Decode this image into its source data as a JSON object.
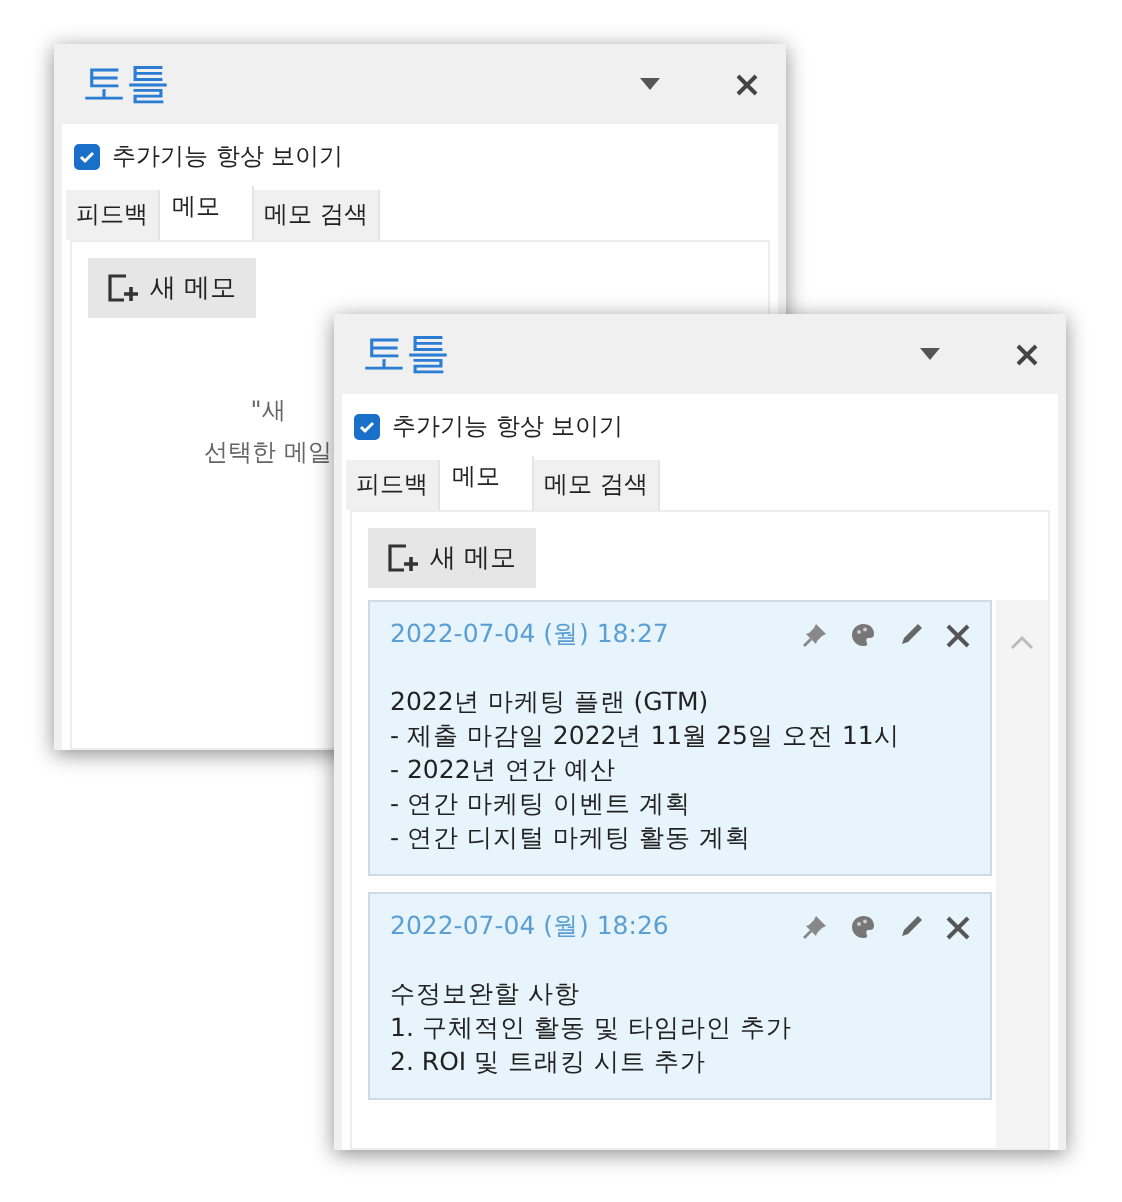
{
  "windows": [
    {
      "title": "토틀",
      "show_addins": {
        "label": "추가기능 항상 보이기",
        "checked": true
      },
      "tabs": [
        {
          "label": "피드백",
          "selected": false
        },
        {
          "label": "메모",
          "selected": true
        },
        {
          "label": "메모 검색",
          "selected": false
        }
      ],
      "new_memo_button": "새 메모",
      "empty_message": [
        "\"새",
        "선택한 메일"
      ]
    },
    {
      "title": "토틀",
      "show_addins": {
        "label": "추가기능 항상 보이기",
        "checked": true
      },
      "tabs": [
        {
          "label": "피드백",
          "selected": false
        },
        {
          "label": "메모",
          "selected": true
        },
        {
          "label": "메모 검색",
          "selected": false
        }
      ],
      "new_memo_button": "새 메모",
      "memos": [
        {
          "date": "2022-07-04 (월) 18:27",
          "lines": [
            "2022년 마케팅 플랜 (GTM)",
            "- 제출 마감일 2022년 11월 25일 오전 11시",
            "- 2022년 연간 예산",
            "- 연간 마케팅 이벤트 계획",
            "- 연간 디지털 마케팅 활동 계획"
          ]
        },
        {
          "date": "2022-07-04 (월) 18:26",
          "lines": [
            "수정보완할 사항",
            "1. 구체적인 활동 및 타임라인 추가",
            "2. ROI 및 트래킹 시트 추가"
          ]
        }
      ]
    }
  ]
}
